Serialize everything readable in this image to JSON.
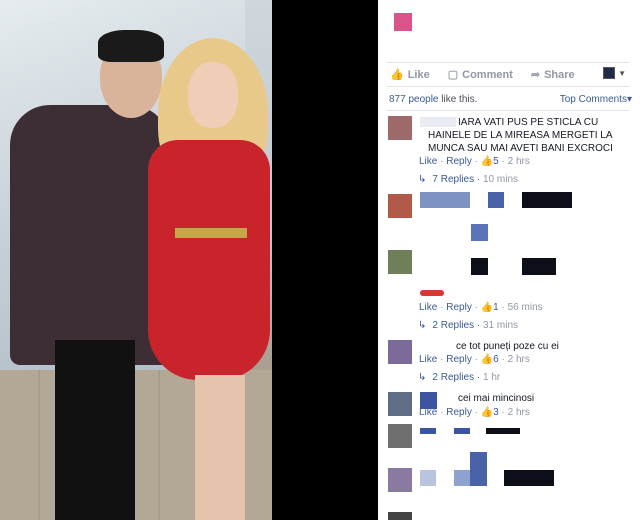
{
  "post_actions": {
    "like": "Like",
    "comment": "Comment",
    "share": "Share"
  },
  "likes": {
    "count": "877 people",
    "suffix": " like this."
  },
  "sort": {
    "label": "Top Comments",
    "caret": "▾"
  },
  "comments": [
    {
      "text": "IARA VATI PUS PE STICLA CU HAINELE DE LA MIREASA MERGETI LA MUNCA SAU MAI AVETI BANI EXCROCI",
      "like": "Like",
      "reply": "Reply",
      "likes": "5",
      "time": "2 hrs",
      "replies": "7 Replies",
      "replies_time": "10 mins"
    },
    {
      "text": "",
      "like": "Like",
      "reply": "Reply",
      "likes": "1",
      "time": "56 mins",
      "replies": "2 Replies",
      "replies_time": "31 mins"
    },
    {
      "text": "ce tot puneți poze cu ei",
      "like": "Like",
      "reply": "Reply",
      "likes": "6",
      "time": "2 hrs",
      "replies": "2 Replies",
      "replies_time": "1 hr"
    },
    {
      "text": "cei mai mincinosi",
      "like": "Like",
      "reply": "Reply",
      "likes": "3",
      "time": "2 hrs"
    }
  ],
  "colors": {
    "accent": "#3b5998",
    "muted": "#9197a3",
    "page_thumb": "#d9548a"
  }
}
